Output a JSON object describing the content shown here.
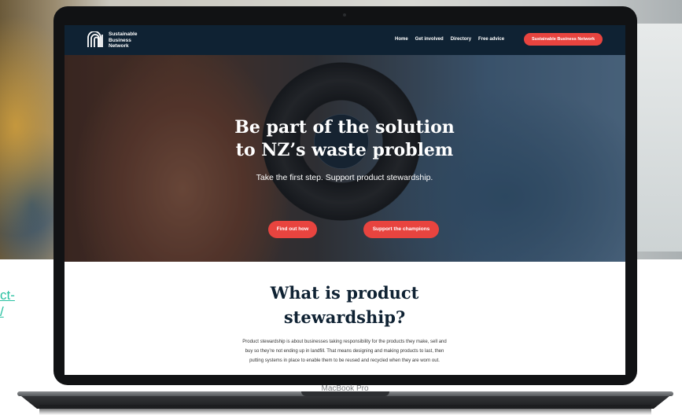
{
  "side_link": {
    "text": "ct-\n/"
  },
  "laptop": {
    "label": "MacBook Pro"
  },
  "site": {
    "logo": {
      "lines": [
        "Sustainable",
        "Business",
        "Network"
      ]
    },
    "nav": {
      "items": [
        "Home",
        "Get involved",
        "Directory",
        "Free advice"
      ]
    },
    "nav_cta": "Sustainable Business Network",
    "hero": {
      "title_line1": "Be part of the solution",
      "title_line2": "to NZ’s waste problem",
      "subtitle": "Take the first step. Support product stewardship.",
      "btn_find": "Find out how",
      "btn_support": "Support the champions"
    },
    "section": {
      "title_line1": "What is product",
      "title_line2": "stewardship?",
      "body": "Product stewardship is about businesses taking responsibility for the products they make, sell and buy so they’re not ending up in landfill. That means designing and making products to last, then putting systems in place to enable them to be reused and recycled when they are worn out."
    }
  },
  "colors": {
    "header_bg": "#0f2233",
    "accent": "#e8443f",
    "link": "#27c0a0"
  },
  "icons": {
    "logo": "sbn-logo-icon"
  }
}
